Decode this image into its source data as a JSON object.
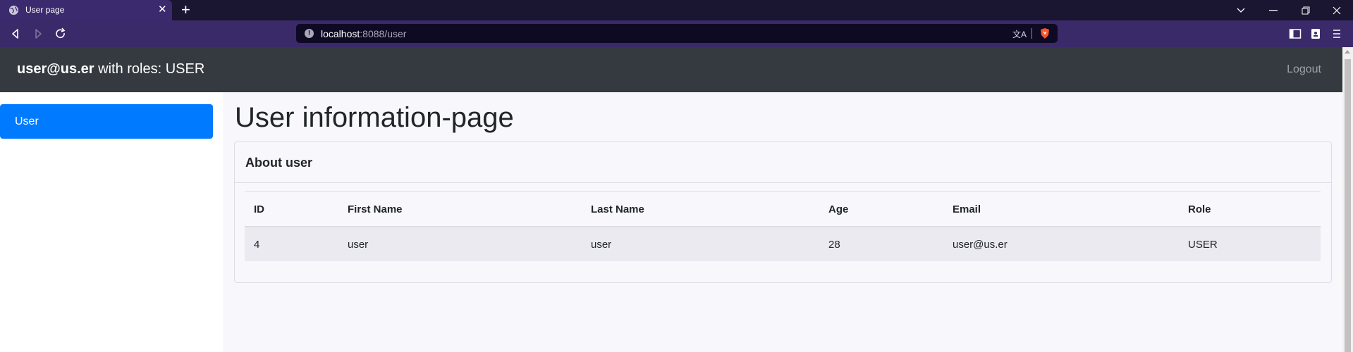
{
  "browser": {
    "tab_title": "User page",
    "url_host": "localhost",
    "url_rest": ":8088/user",
    "translate_glyph": "文A"
  },
  "header": {
    "user_email": "user@us.er",
    "roles_text": " with roles: USER",
    "logout_label": "Logout"
  },
  "sidebar": {
    "items": [
      {
        "label": "User"
      }
    ]
  },
  "main": {
    "title": "User information-page",
    "card_title": "About user",
    "table": {
      "columns": [
        "ID",
        "First Name",
        "Last Name",
        "Age",
        "Email",
        "Role"
      ],
      "rows": [
        [
          "4",
          "user",
          "user",
          "28",
          "user@us.er",
          "USER"
        ]
      ]
    }
  },
  "colors": {
    "accent": "#007bff",
    "header_bg": "#343a40"
  }
}
